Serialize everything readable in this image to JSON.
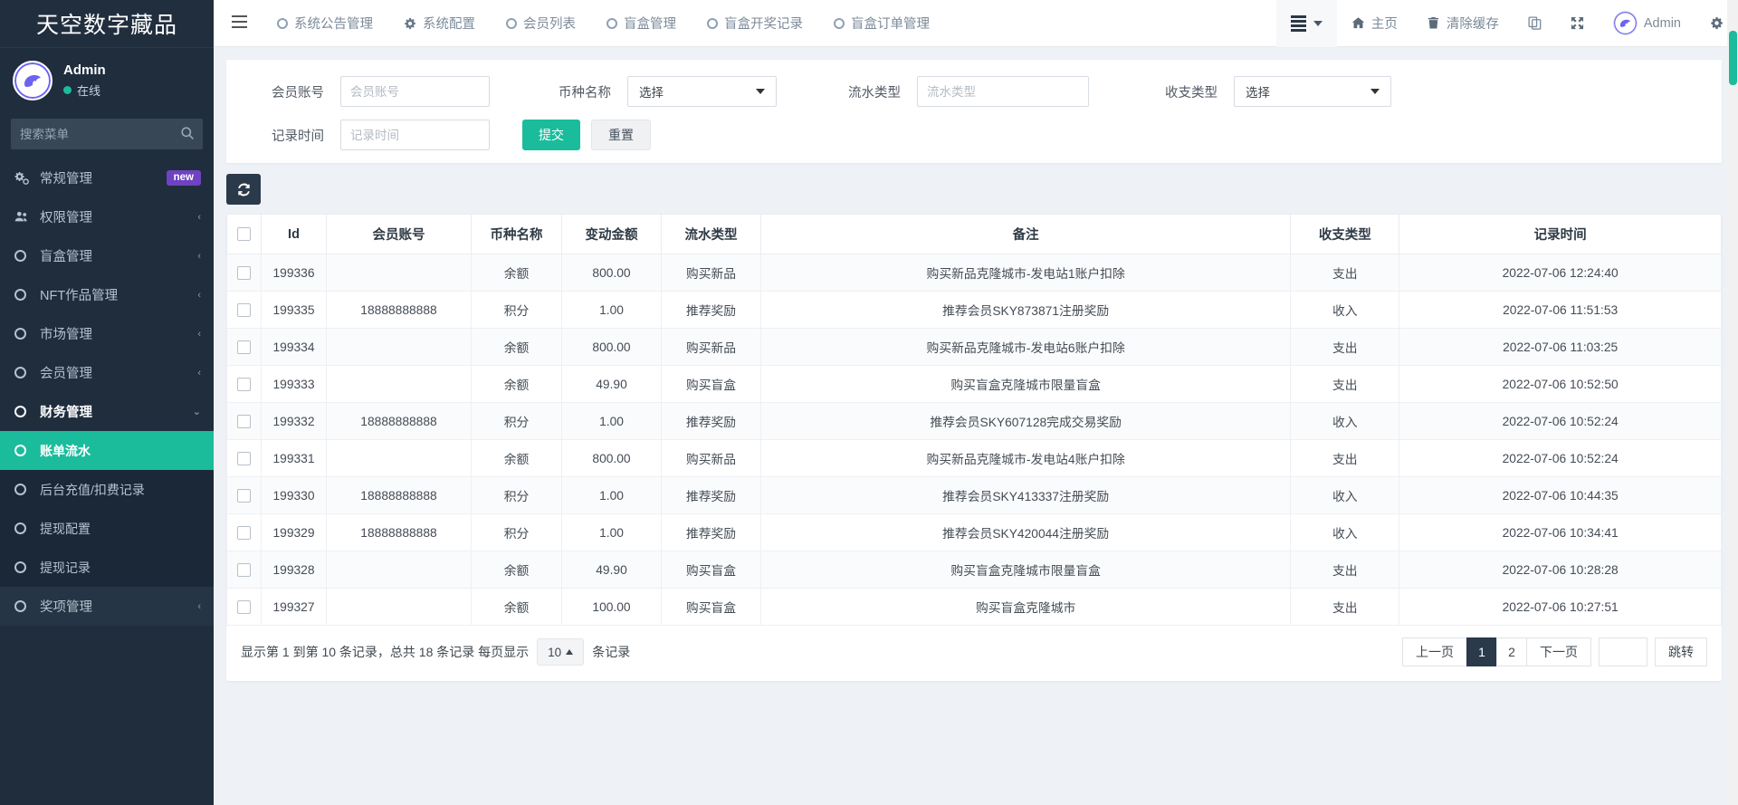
{
  "sidebar": {
    "brand": "天空数字藏品",
    "user": {
      "name": "Admin",
      "status": "在线"
    },
    "search": {
      "placeholder": "搜索菜单",
      "value": "",
      "icon": "search-icon"
    },
    "items": [
      {
        "label": "常规管理",
        "icon": "gears-icon",
        "badge": "new",
        "chevron": "",
        "level": 1
      },
      {
        "label": "权限管理",
        "icon": "users-icon",
        "badge": "",
        "chevron": "‹",
        "level": 1
      },
      {
        "label": "盲盒管理",
        "icon": "circle-icon",
        "badge": "",
        "chevron": "‹",
        "level": 1
      },
      {
        "label": "NFT作品管理",
        "icon": "circle-icon",
        "badge": "",
        "chevron": "‹",
        "level": 1
      },
      {
        "label": "市场管理",
        "icon": "circle-icon",
        "badge": "",
        "chevron": "‹",
        "level": 1
      },
      {
        "label": "会员管理",
        "icon": "circle-icon",
        "badge": "",
        "chevron": "‹",
        "level": 1
      },
      {
        "label": "财务管理",
        "icon": "circle-icon",
        "badge": "",
        "chevron": "⌄",
        "level": 1,
        "expanded": true
      },
      {
        "label": "账单流水",
        "icon": "circle-icon",
        "badge": "",
        "chevron": "",
        "level": 2,
        "active": true
      },
      {
        "label": "后台充值/扣费记录",
        "icon": "circle-icon",
        "badge": "",
        "chevron": "",
        "level": 2
      },
      {
        "label": "提现配置",
        "icon": "circle-icon",
        "badge": "",
        "chevron": "",
        "level": 2
      },
      {
        "label": "提现记录",
        "icon": "circle-icon",
        "badge": "",
        "chevron": "",
        "level": 2
      },
      {
        "label": "奖项管理",
        "icon": "circle-icon",
        "badge": "",
        "chevron": "‹",
        "level": 1
      }
    ]
  },
  "topbar": {
    "menu_toggle_icon": "hamburger-icon",
    "nav": [
      {
        "label": "系统公告管理",
        "icon": "circle-icon"
      },
      {
        "label": "系统配置",
        "icon": "gear-icon"
      },
      {
        "label": "会员列表",
        "icon": "circle-icon"
      },
      {
        "label": "盲盒管理",
        "icon": "circle-icon"
      },
      {
        "label": "盲盒开奖记录",
        "icon": "circle-icon"
      },
      {
        "label": "盲盒订单管理",
        "icon": "circle-icon"
      }
    ],
    "right": [
      {
        "label": "",
        "icon": "bars-dropdown-icon",
        "boxed": true
      },
      {
        "label": "主页",
        "icon": "home-icon"
      },
      {
        "label": "清除缓存",
        "icon": "trash-icon"
      },
      {
        "label": "",
        "icon": "copy-icon"
      },
      {
        "label": "",
        "icon": "fullscreen-icon"
      },
      {
        "label": "Admin",
        "icon": "avatar-icon"
      },
      {
        "label": "",
        "icon": "settings-gear-icon"
      }
    ]
  },
  "filters": {
    "account": {
      "label": "会员账号",
      "placeholder": "会员账号",
      "value": ""
    },
    "currency": {
      "label": "币种名称",
      "selected": "选择"
    },
    "flow_type": {
      "label": "流水类型",
      "placeholder": "流水类型",
      "value": ""
    },
    "io_type": {
      "label": "收支类型",
      "selected": "选择"
    },
    "record_time": {
      "label": "记录时间",
      "placeholder": "记录时间",
      "value": ""
    },
    "submit_label": "提交",
    "reset_label": "重置"
  },
  "toolbar": {
    "refresh_icon": "refresh-icon"
  },
  "table": {
    "columns": [
      "",
      "Id",
      "会员账号",
      "币种名称",
      "变动金额",
      "流水类型",
      "备注",
      "收支类型",
      "记录时间"
    ],
    "rows": [
      {
        "id": "199336",
        "account": "",
        "currency": "余额",
        "amount": "800.00",
        "flow": "购买新品",
        "remark": "购买新品克隆城市-发电站1账户扣除",
        "io": "支出",
        "io_kind": "out",
        "time": "2022-07-06 12:24:40"
      },
      {
        "id": "199335",
        "account": "18888888888",
        "currency": "积分",
        "amount": "1.00",
        "flow": "推荐奖励",
        "remark": "推荐会员SKY873871注册奖励",
        "io": "收入",
        "io_kind": "in",
        "time": "2022-07-06 11:51:53"
      },
      {
        "id": "199334",
        "account": "",
        "currency": "余额",
        "amount": "800.00",
        "flow": "购买新品",
        "remark": "购买新品克隆城市-发电站6账户扣除",
        "io": "支出",
        "io_kind": "out",
        "time": "2022-07-06 11:03:25"
      },
      {
        "id": "199333",
        "account": "",
        "currency": "余额",
        "amount": "49.90",
        "flow": "购买盲盒",
        "remark": "购买盲盒克隆城市限量盲盒",
        "io": "支出",
        "io_kind": "out",
        "time": "2022-07-06 10:52:50"
      },
      {
        "id": "199332",
        "account": "18888888888",
        "currency": "积分",
        "amount": "1.00",
        "flow": "推荐奖励",
        "remark": "推荐会员SKY607128完成交易奖励",
        "io": "收入",
        "io_kind": "in",
        "time": "2022-07-06 10:52:24"
      },
      {
        "id": "199331",
        "account": "",
        "currency": "余额",
        "amount": "800.00",
        "flow": "购买新品",
        "remark": "购买新品克隆城市-发电站4账户扣除",
        "io": "支出",
        "io_kind": "out",
        "time": "2022-07-06 10:52:24"
      },
      {
        "id": "199330",
        "account": "18888888888",
        "currency": "积分",
        "amount": "1.00",
        "flow": "推荐奖励",
        "remark": "推荐会员SKY413337注册奖励",
        "io": "收入",
        "io_kind": "in",
        "time": "2022-07-06 10:44:35"
      },
      {
        "id": "199329",
        "account": "18888888888",
        "currency": "积分",
        "amount": "1.00",
        "flow": "推荐奖励",
        "remark": "推荐会员SKY420044注册奖励",
        "io": "收入",
        "io_kind": "in",
        "time": "2022-07-06 10:34:41"
      },
      {
        "id": "199328",
        "account": "",
        "currency": "余额",
        "amount": "49.90",
        "flow": "购买盲盒",
        "remark": "购买盲盒克隆城市限量盲盒",
        "io": "支出",
        "io_kind": "out",
        "time": "2022-07-06 10:28:28"
      },
      {
        "id": "199327",
        "account": "",
        "currency": "余额",
        "amount": "100.00",
        "flow": "购买盲盒",
        "remark": "购买盲盒克隆城市",
        "io": "支出",
        "io_kind": "out",
        "time": "2022-07-06 10:27:51"
      }
    ]
  },
  "footer": {
    "summary_prefix": "显示第 1 到第 10 条记录，总共 18 条记录 每页显示",
    "page_size": "10",
    "summary_suffix": "条记录",
    "prev_label": "上一页",
    "pages": [
      "1",
      "2"
    ],
    "active_page": "1",
    "next_label": "下一页",
    "jump_value": "",
    "jump_label": "跳转"
  },
  "colors": {
    "accent": "#1abc9c",
    "sidebar_bg": "#1f2d3d",
    "sidebar_sub_bg": "#1b2838",
    "badge": "#6f42c1",
    "dark_btn": "#2b3a4a"
  }
}
